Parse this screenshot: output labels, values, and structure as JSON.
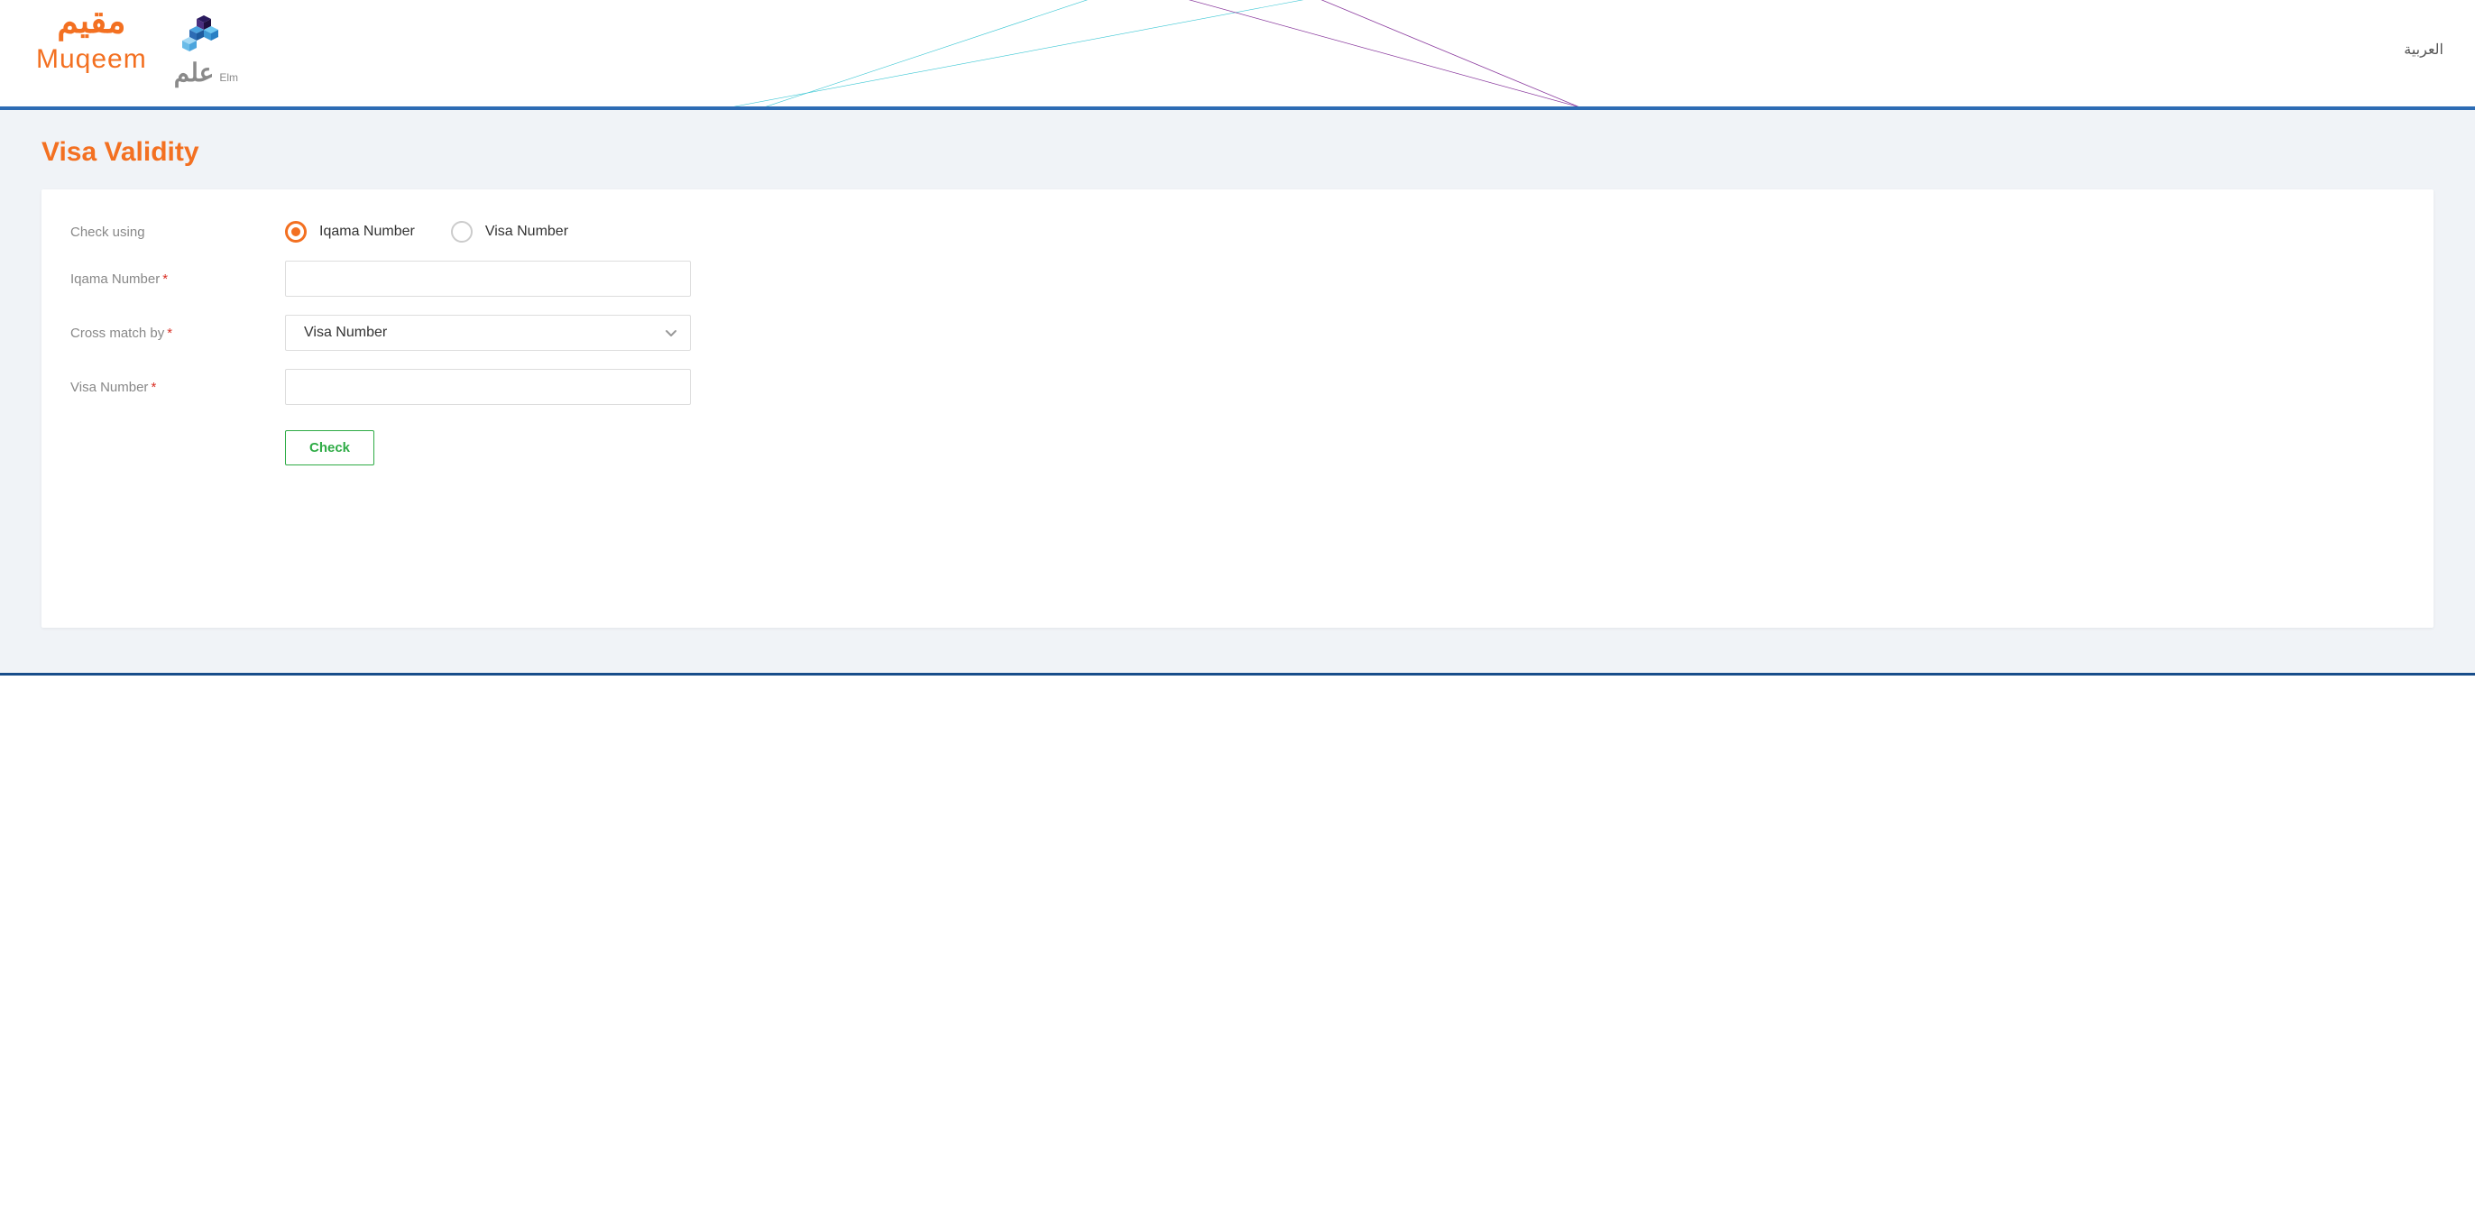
{
  "header": {
    "brand_ar": "مقيم",
    "brand_en": "Muqeem",
    "partner_ar": "علم",
    "partner_en": "Elm",
    "language_toggle": "العربية"
  },
  "page": {
    "title": "Visa Validity"
  },
  "form": {
    "check_using_label": "Check using",
    "radio_options": [
      {
        "label": "Iqama Number",
        "selected": true
      },
      {
        "label": "Visa Number",
        "selected": false
      }
    ],
    "iqama_number_label": "Iqama Number",
    "iqama_number_value": "",
    "cross_match_label": "Cross match by",
    "cross_match_selected": "Visa Number",
    "visa_number_label": "Visa Number",
    "visa_number_value": "",
    "check_button_label": "Check"
  },
  "colors": {
    "accent_orange": "#f37021",
    "accent_blue": "#2d6cb4",
    "accent_green": "#2eab45"
  }
}
